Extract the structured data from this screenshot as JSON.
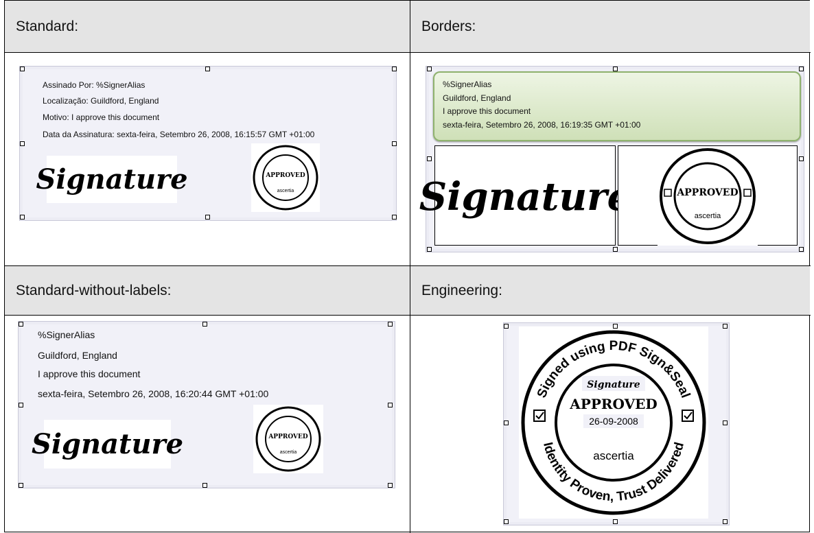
{
  "headers": {
    "standard": "Standard:",
    "borders": "Borders:",
    "standard_without_labels": "Standard-without-labels:",
    "engineering": "Engineering:"
  },
  "standard": {
    "lines": [
      "Assinado Por: %SignerAlias",
      "Localização: Guildford, England",
      "Motivo: I approve this document",
      "Data da Assinatura: sexta-feira, Setembro 26, 2008, 16:15:57 GMT +01:00"
    ]
  },
  "borders": {
    "lines": [
      "%SignerAlias",
      "Guildford, England",
      "I approve this document",
      "sexta-feira, Setembro 26, 2008, 16:19:35 GMT +01:00"
    ]
  },
  "standard_without_labels": {
    "lines": [
      "%SignerAlias",
      "Guildford, England",
      "I approve this document",
      "sexta-feira, Setembro 26, 2008, 16:20:44 GMT +01:00"
    ]
  },
  "engineering": {
    "ring_top": "Signed using PDF Sign&Seal",
    "ring_bottom": "Identity Proven, Trust Delivered",
    "approved": "APPROVED",
    "date": "26-09-2008",
    "brand": "ascertia"
  },
  "stamp": {
    "ring_top": "Signed using PDF Sign&Seal",
    "ring_bottom": "Identity Proven, Trust Delivered",
    "approved": "APPROVED",
    "brand": "ascertia"
  },
  "signature_image_text": "Signature",
  "colors": {
    "header_bg": "#e4e4e4",
    "box_bg": "#f1f1f8",
    "green_border": "#8fb26e"
  }
}
